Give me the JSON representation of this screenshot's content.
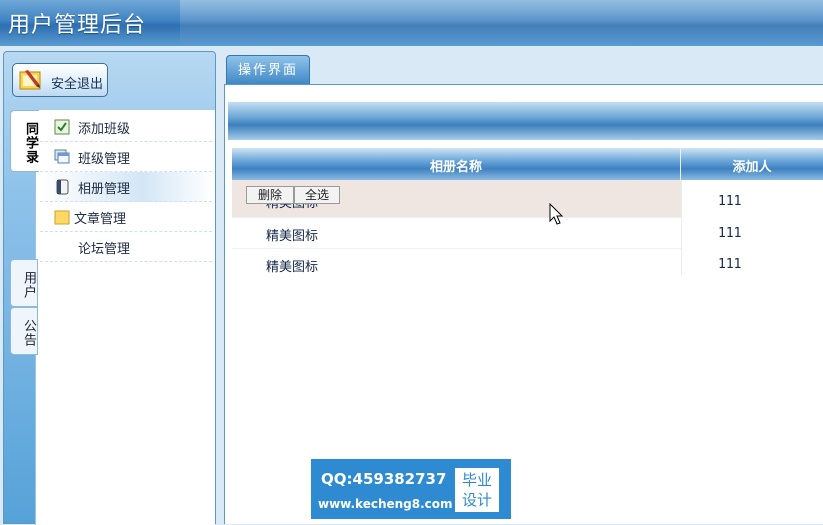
{
  "header": {
    "title": "用户管理后台"
  },
  "sidebar": {
    "logout_label": "安全退出",
    "tabs": [
      {
        "label": "同学录",
        "active": true
      },
      {
        "label": "用户",
        "active": false
      },
      {
        "label": "公告",
        "active": false
      }
    ],
    "items": [
      {
        "label": "添加班级",
        "icon": "checkbox-icon"
      },
      {
        "label": "班级管理",
        "icon": "window-stack-icon"
      },
      {
        "label": "相册管理",
        "icon": "album-icon",
        "active": true
      },
      {
        "label": "文章管理",
        "icon": "folder-icon"
      },
      {
        "label": "论坛管理",
        "icon": ""
      }
    ]
  },
  "main": {
    "tab_label": "操作界面",
    "table": {
      "headers": [
        "相册名称",
        "添加人"
      ],
      "rows": [
        {
          "name": "精美图标",
          "adder": "111"
        },
        {
          "name": "精美图标",
          "adder": "111"
        },
        {
          "name": "精美图标",
          "adder": "111"
        }
      ],
      "delete_label": "删除",
      "select_all_label": "全选"
    }
  },
  "watermark": {
    "qq": "QQ:459382737",
    "url": "www.kecheng8.com",
    "badge_line1": "毕业",
    "badge_line2": "设计"
  },
  "colors": {
    "header_blue": "#3f83c2",
    "accent_blue": "#2f8bd1",
    "row_highlight": "#efe6e1"
  }
}
